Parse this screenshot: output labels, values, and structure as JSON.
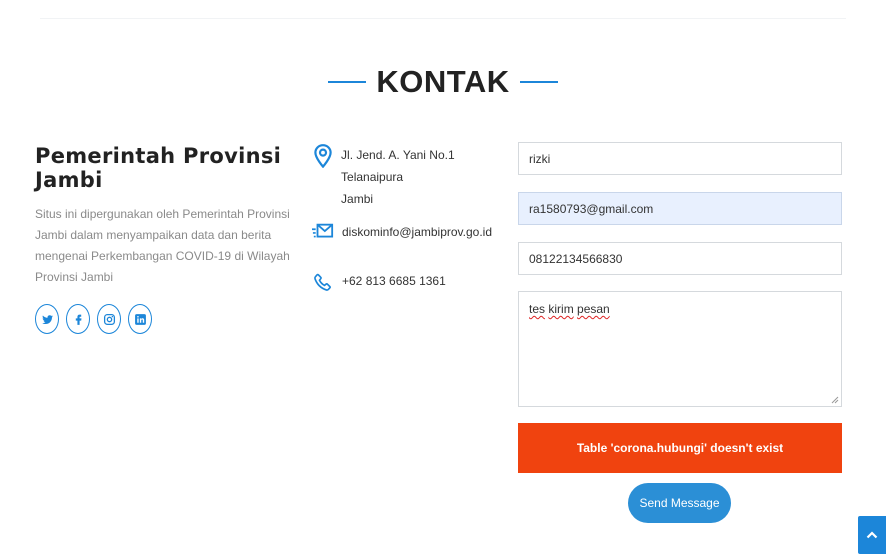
{
  "section": {
    "title": "KONTAK"
  },
  "org": {
    "name": "Pemerintah Provinsi Jambi",
    "description": "Situs ini dipergunakan oleh Pemerintah Provinsi Jambi dalam menyampaikan data dan berita mengenai Perkembangan COVID-19 di Wilayah Provinsi Jambi",
    "socials": [
      "twitter-icon",
      "facebook-icon",
      "instagram-icon",
      "linkedin-icon"
    ]
  },
  "contact": {
    "address_line1": "Jl. Jend. A. Yani No.1 Telanaipura",
    "address_line2": "Jambi",
    "email": "diskominfo@jambiprov.go.id",
    "phone": "+62 813 6685 1361"
  },
  "form": {
    "name_value": "rizki",
    "email_value": "ra1580793@gmail.com",
    "phone_value": "08122134566830",
    "message_words": [
      "tes",
      "kirim",
      "pesan"
    ],
    "error_message": "Table 'corona.hubungi' doesn't exist",
    "send_label": "Send Message"
  },
  "colors": {
    "accent": "#1c86d9",
    "error": "#f0430f",
    "button": "#2b8fd6",
    "autofill": "#e8f0fe"
  }
}
